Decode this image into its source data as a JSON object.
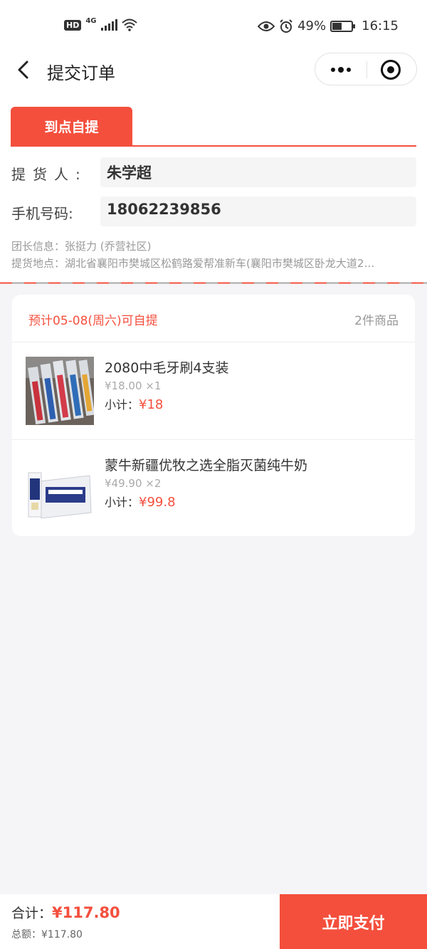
{
  "status_bar": {
    "hd": "HD",
    "network": "4G",
    "battery_pct": "49%",
    "time": "16:15"
  },
  "nav": {
    "title": "提交订单"
  },
  "tab": {
    "label": "到点自提"
  },
  "form": {
    "receiver_label": "提货人:",
    "receiver_value": "朱学超",
    "phone_label": "手机号码:",
    "phone_value": "18062239856"
  },
  "info": {
    "leader": "团长信息：张挺力 (乔营社区)",
    "address": "提货地点：湖北省襄阳市樊城区松鹤路爱帮准新车(襄阳市樊城区卧龙大道2…"
  },
  "order": {
    "pickup_date": "预计05-08(周六)可自提",
    "item_count": "2件商品",
    "items": [
      {
        "name": "2080中毛牙刷4支装",
        "price": "¥18.00 ×1",
        "subtotal_label": "小计：",
        "subtotal": "¥18",
        "image": "toothbrush-pack"
      },
      {
        "name": "蒙牛新疆优牧之选全脂灭菌纯牛奶",
        "price": "¥49.90 ×2",
        "subtotal_label": "小计：",
        "subtotal": "¥99.8",
        "image": "milk-carton-box"
      }
    ]
  },
  "footer": {
    "total_label": "合计：",
    "total_value": "¥117.80",
    "sum_text": "总额：¥117.80",
    "pay_button": "立即支付"
  },
  "colors": {
    "accent": "#f44f3d",
    "background": "#f5f5f7"
  }
}
